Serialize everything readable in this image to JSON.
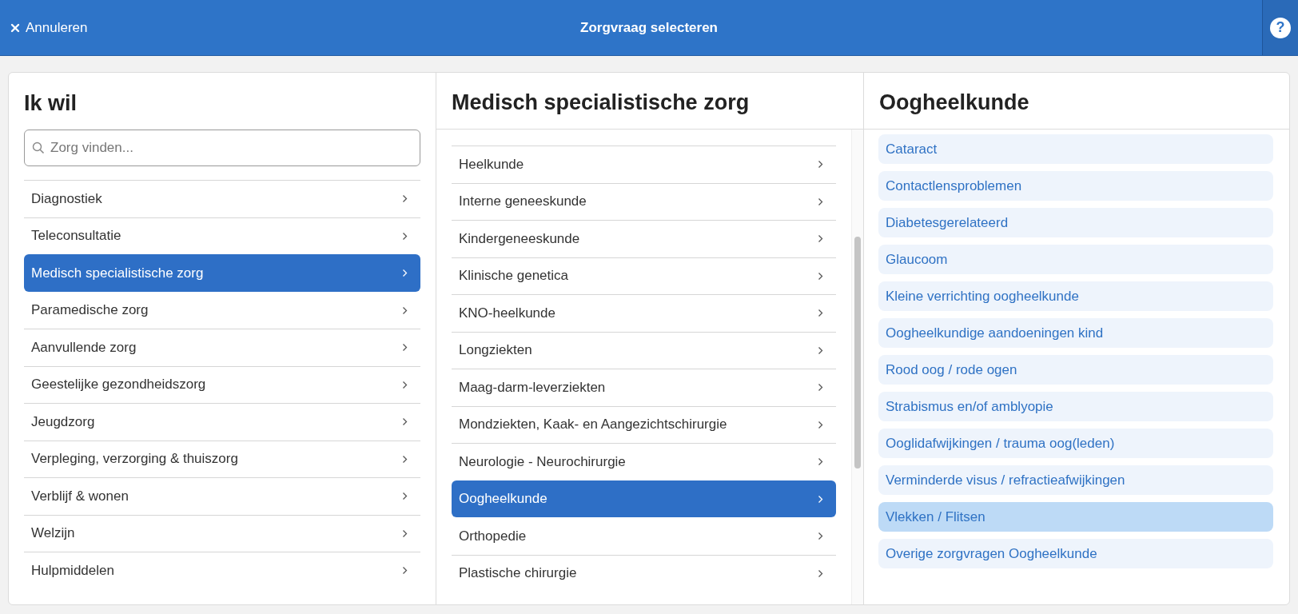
{
  "top_bar": {
    "cancel": "Annuleren",
    "title": "Zorgvraag selecteren",
    "help": "?"
  },
  "columns": [
    {
      "title": "Ik wil",
      "search": {
        "placeholder": "Zorg vinden..."
      },
      "items": [
        {
          "label": "Diagnostiek",
          "selected": false
        },
        {
          "label": "Teleconsultatie",
          "selected": false
        },
        {
          "label": "Medisch specialistische zorg",
          "selected": true
        },
        {
          "label": "Paramedische zorg",
          "selected": false
        },
        {
          "label": "Aanvullende zorg",
          "selected": false
        },
        {
          "label": "Geestelijke gezondheidszorg",
          "selected": false
        },
        {
          "label": "Jeugdzorg",
          "selected": false
        },
        {
          "label": "Verpleging, verzorging & thuiszorg",
          "selected": false
        },
        {
          "label": "Verblijf & wonen",
          "selected": false
        },
        {
          "label": "Welzijn",
          "selected": false
        },
        {
          "label": "Hulpmiddelen",
          "selected": false
        }
      ]
    },
    {
      "title": "Medisch specialistische zorg",
      "items": [
        {
          "label": "Heelkunde",
          "selected": false
        },
        {
          "label": "Interne geneeskunde",
          "selected": false
        },
        {
          "label": "Kindergeneeskunde",
          "selected": false
        },
        {
          "label": "Klinische genetica",
          "selected": false
        },
        {
          "label": "KNO-heelkunde",
          "selected": false
        },
        {
          "label": "Longziekten",
          "selected": false
        },
        {
          "label": "Maag-darm-leverziekten",
          "selected": false
        },
        {
          "label": "Mondziekten, Kaak- en Aangezichtschirurgie",
          "selected": false
        },
        {
          "label": "Neurologie - Neurochirurgie",
          "selected": false
        },
        {
          "label": "Oogheelkunde",
          "selected": true
        },
        {
          "label": "Orthopedie",
          "selected": false
        },
        {
          "label": "Plastische chirurgie",
          "selected": false
        }
      ]
    },
    {
      "title": "Oogheelkunde",
      "options": [
        {
          "label": "Cataract",
          "hovered": false
        },
        {
          "label": "Contactlensproblemen",
          "hovered": false
        },
        {
          "label": "Diabetesgerelateerd",
          "hovered": false
        },
        {
          "label": "Glaucoom",
          "hovered": false
        },
        {
          "label": "Kleine verrichting oogheelkunde",
          "hovered": false
        },
        {
          "label": "Oogheelkundige aandoeningen kind",
          "hovered": false
        },
        {
          "label": "Rood oog / rode ogen",
          "hovered": false
        },
        {
          "label": "Strabismus en/of amblyopie",
          "hovered": false
        },
        {
          "label": "Ooglidafwijkingen / trauma oog(leden)",
          "hovered": false
        },
        {
          "label": "Verminderde visus / refractieafwijkingen",
          "hovered": false
        },
        {
          "label": "Vlekken / Flitsen",
          "hovered": true
        },
        {
          "label": "Overige zorgvragen Oogheelkunde",
          "hovered": false
        }
      ]
    }
  ]
}
